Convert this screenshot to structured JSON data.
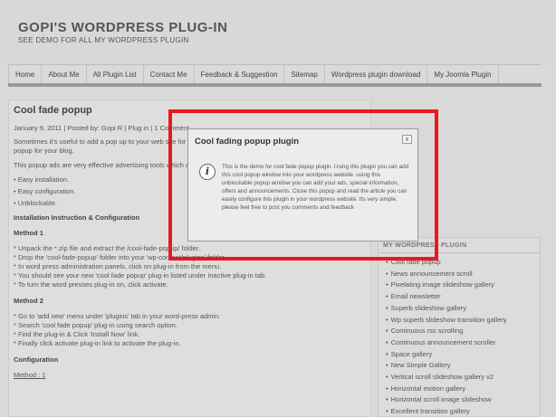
{
  "site": {
    "title": "GOPI'S WORDPRESS PLUG-IN",
    "subtitle": "SEE DEMO FOR ALL MY WORDPRESS PLUGIN"
  },
  "nav": {
    "items": [
      "Home",
      "About Me",
      "All Plugin List",
      "Contact Me",
      "Feedback & Suggestion",
      "Sitemap",
      "Wordpress plugin download",
      "My Joomla Plugin"
    ]
  },
  "post": {
    "title": "Cool fade popup",
    "meta": "January 9, 2011 | Posted by: Gopi R | Plug in | 1 Comment",
    "para1": "Sometimes it's useful to add a pop up to your web site for offers. Using this plug-in you can creates unblockable popup for your blog.",
    "para2": "This popup ads are very effective advertising tools which are not blocked by popup blocking tool.",
    "bullets": [
      "• Easy installation.",
      "• Easy configuration.",
      "• Unblockable."
    ],
    "heading_install": "Installation Instruction & Configuration",
    "method1": "Method 1",
    "steps1": [
      "* Unpack the *.zip file and extract the /cool-fade-popup/ folder.",
      "* Drop the 'cool-fade-popup' folder into your 'wp-content/plugins' folder.",
      "* In word press administration panels, click on plug-in from the menu.",
      "* You should see your new 'cool fade popup' plug-in listed under Inactive plug-in tab.",
      "* To turn the word presses plug-in on, click activate."
    ],
    "method2": "Method 2",
    "steps2": [
      "* Go to 'add new' menu under 'plugins' tab in your word-press admin.",
      "* Search 'cool fade popup' plug-in using search option.",
      "* Find the plug-in & Click 'Install Now' link.",
      "* Finally click activate plug-in link to activate the plug-in."
    ],
    "heading_config": "Configuration",
    "method1_ul": "Method : 1"
  },
  "sidebar": {
    "title": "MY WORDPRESS PLUGIN",
    "items": [
      "Cool fade popup",
      "News announcement scroll",
      "Pixelating image slideshow gallery",
      "Email newsletter",
      "Superb slideshow gallery",
      "Wp superb slideshow transition gallery",
      "Continuous rss scrolling",
      "Continuous announcement scroller",
      "Space gallery",
      "New Simple Gallery",
      "Vertical scroll slideshow gallery v2",
      "Horizontal motion gallery",
      "Horizontal scroll image slideshow",
      "Excellent transition gallery"
    ]
  },
  "popup": {
    "title": "Cool fading popup plugin",
    "close": "x",
    "info_glyph": "i",
    "text": "This is the demo for cool fade popup plugin. Using this plugin you can add this cool popup window into your wordpress website. using this unblockable popup window you can add your ads, special information, offers and announcements. Close this popup and read the article you can easily configure this plugin in your wordpress website. Its very simple. please feel free to post you comments and feedback"
  },
  "colors": {
    "highlight": "#e8191d"
  }
}
